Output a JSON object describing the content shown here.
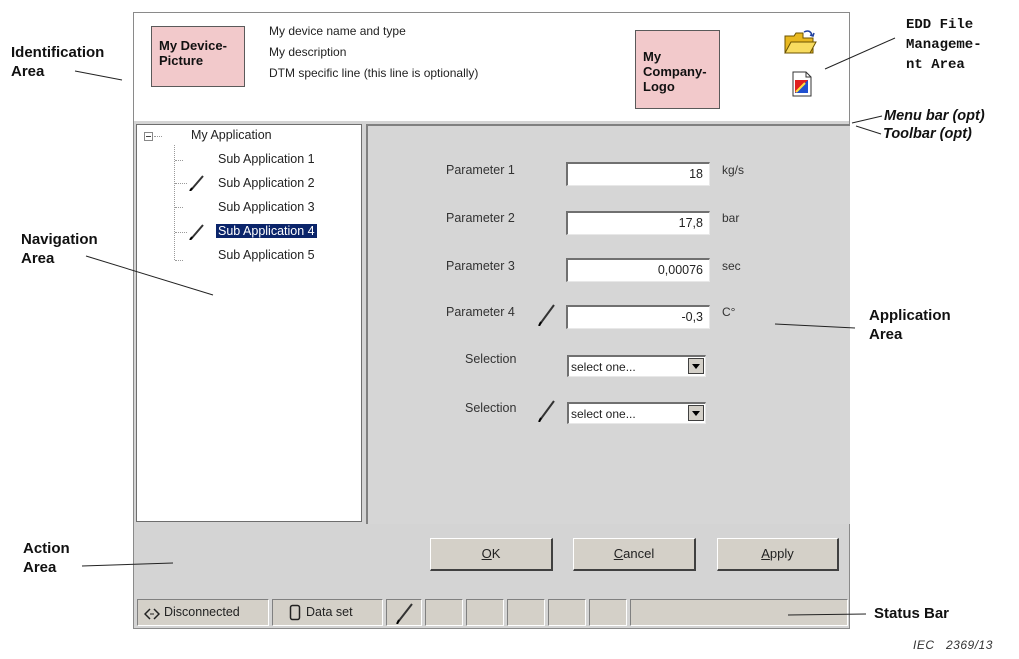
{
  "identification": {
    "picture_label": "My Device-\nPicture",
    "lines": [
      "My device name and type",
      "My description",
      "DTM specific line (this line is optionally)"
    ],
    "logo_label": "My\nCompany-\nLogo",
    "icons": [
      "folder-open-icon",
      "document-edit-icon"
    ]
  },
  "navigation": {
    "root": "My Application",
    "items": [
      {
        "label": "Sub Application 1",
        "edited": false,
        "selected": false
      },
      {
        "label": "Sub Application 2",
        "edited": true,
        "selected": false
      },
      {
        "label": "Sub Application 3",
        "edited": false,
        "selected": false
      },
      {
        "label": "Sub Application 4",
        "edited": true,
        "selected": true
      },
      {
        "label": "Sub Application 5",
        "edited": false,
        "selected": false
      }
    ]
  },
  "application": {
    "parameters": [
      {
        "label": "Parameter 1",
        "value": "18",
        "unit": "kg/s",
        "edited": false
      },
      {
        "label": "Parameter 2",
        "value": "17,8",
        "unit": "bar",
        "edited": false
      },
      {
        "label": "Parameter 3",
        "value": "0,00076",
        "unit": "sec",
        "edited": false
      },
      {
        "label": "Parameter 4",
        "value": "-0,3",
        "unit": "C°",
        "edited": true
      }
    ],
    "selections": [
      {
        "label": "Selection",
        "value": "select one...",
        "edited": false
      },
      {
        "label": "Selection",
        "value": "select one...",
        "edited": true
      }
    ]
  },
  "actions": {
    "ok": {
      "accel": "O",
      "rest": "K"
    },
    "cancel": {
      "accel": "C",
      "rest": "ancel"
    },
    "apply": {
      "accel": "A",
      "rest": "pply"
    }
  },
  "status_bar": {
    "connection": "Disconnected",
    "dataset": "Data set",
    "icons": [
      "connection-icon",
      "dataset-icon",
      "pencil-icon"
    ]
  },
  "callouts": {
    "identification": "Identification\nArea",
    "edd": "EDD File\nManageme-\nnt Area",
    "menu_bar": "Menu bar (opt)",
    "toolbar": "Toolbar (opt)",
    "navigation": "Navigation\nArea",
    "application": "Application\nArea",
    "action": "Action\nArea",
    "status": "Status Bar"
  },
  "footnote": "IEC   2369/13"
}
